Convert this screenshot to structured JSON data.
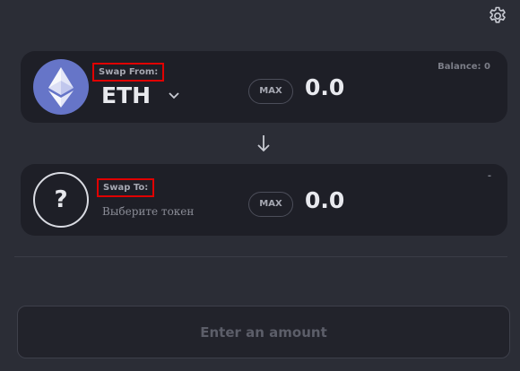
{
  "settings": {
    "icon": "gear-icon"
  },
  "from": {
    "label": "Swap From:",
    "token_symbol": "ETH",
    "token_icon": "ethereum-icon",
    "max_label": "MAX",
    "amount": "0.0",
    "balance": "Balance: 0"
  },
  "direction": {
    "icon": "arrow-down-icon"
  },
  "to": {
    "label": "Swap To:",
    "token_placeholder_symbol": "?",
    "token_hint": "Выберите токен",
    "max_label": "MAX",
    "amount": "0.0",
    "balance": "-"
  },
  "action": {
    "label": "Enter an amount"
  },
  "colors": {
    "background": "#2b2d36",
    "panel": "#1e1f27",
    "eth_icon": "#6675c8",
    "highlight_box": "#e00000"
  }
}
